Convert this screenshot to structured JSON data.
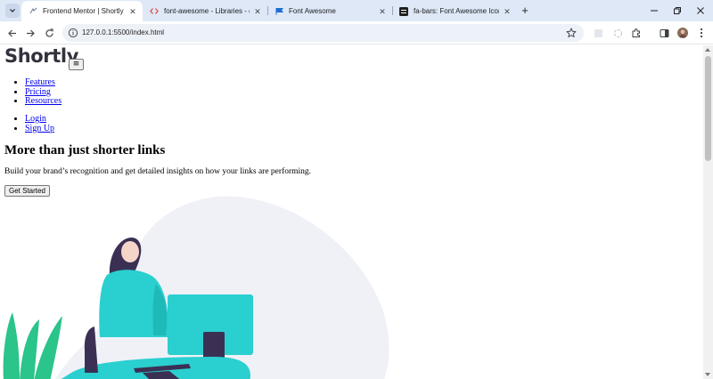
{
  "browser": {
    "tabs": [
      {
        "title": "Frontend Mentor | Shortly URL",
        "active": true,
        "favicon": "frontend-mentor-icon"
      },
      {
        "title": "font-awesome - Libraries - cdnj",
        "active": false,
        "favicon": "cdnjs-icon"
      },
      {
        "title": "Font Awesome",
        "active": false,
        "favicon": "font-awesome-flag-icon"
      },
      {
        "title": "fa-bars: Font Awesome Icons",
        "active": false,
        "favicon": "font-awesome-bars-icon"
      }
    ],
    "url": "127.0.0.1:5500/index.html"
  },
  "page": {
    "logo": "Shortly",
    "menu_button": "≡",
    "nav_primary": [
      "Features",
      "Pricing",
      "Resources"
    ],
    "nav_auth": [
      "Login",
      "Sign Up"
    ],
    "hero": {
      "title": "More than just shorter links",
      "text": "Build your brand’s recognition and get detailed insights on how your links are performing.",
      "cta": "Get Started"
    }
  },
  "colors": {
    "logo": "#34313d",
    "link": "#0000ee",
    "tabbar": "#dee8f6",
    "illustration_teal": "#2acfcf",
    "illustration_dark": "#3b3054",
    "blob": "#eff1f7"
  }
}
